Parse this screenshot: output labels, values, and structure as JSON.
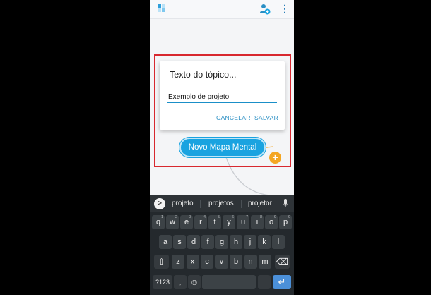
{
  "toolbar": {
    "logo_icon": "mindmap-logo-icon",
    "add_user_icon": "add-user-icon",
    "menu_icon": "more-vert-icon",
    "menu_glyph": "⋮"
  },
  "dialog": {
    "title": "Texto do tópico...",
    "input_value": "Exemplo de projeto",
    "cancel_label": "CANCELAR",
    "save_label": "SALVAR"
  },
  "node": {
    "label": "Novo Mapa Mental",
    "add_glyph": "+"
  },
  "keyboard": {
    "expand_glyph": ">",
    "suggestions": [
      "projeto",
      "projetos",
      "projetor"
    ],
    "row1": [
      {
        "k": "q",
        "n": "1"
      },
      {
        "k": "w",
        "n": "2"
      },
      {
        "k": "e",
        "n": "3"
      },
      {
        "k": "r",
        "n": "4"
      },
      {
        "k": "t",
        "n": "5"
      },
      {
        "k": "y",
        "n": "6"
      },
      {
        "k": "u",
        "n": "7"
      },
      {
        "k": "i",
        "n": "8"
      },
      {
        "k": "o",
        "n": "9"
      },
      {
        "k": "p",
        "n": "0"
      }
    ],
    "row2": [
      "a",
      "s",
      "d",
      "f",
      "g",
      "h",
      "j",
      "k",
      "l"
    ],
    "row3": [
      "z",
      "x",
      "c",
      "v",
      "b",
      "n",
      "m"
    ],
    "shift_glyph": "⇧",
    "backspace_glyph": "⌫",
    "symbols_label": "?123",
    "comma_label": ",",
    "emoji_glyph": "☺",
    "period_label": ".",
    "enter_glyph": "↵"
  },
  "colors": {
    "accent": "#1aa3e0",
    "node_add": "#f4a623",
    "highlight": "#d8282f",
    "enter_key": "#4b90d9"
  }
}
